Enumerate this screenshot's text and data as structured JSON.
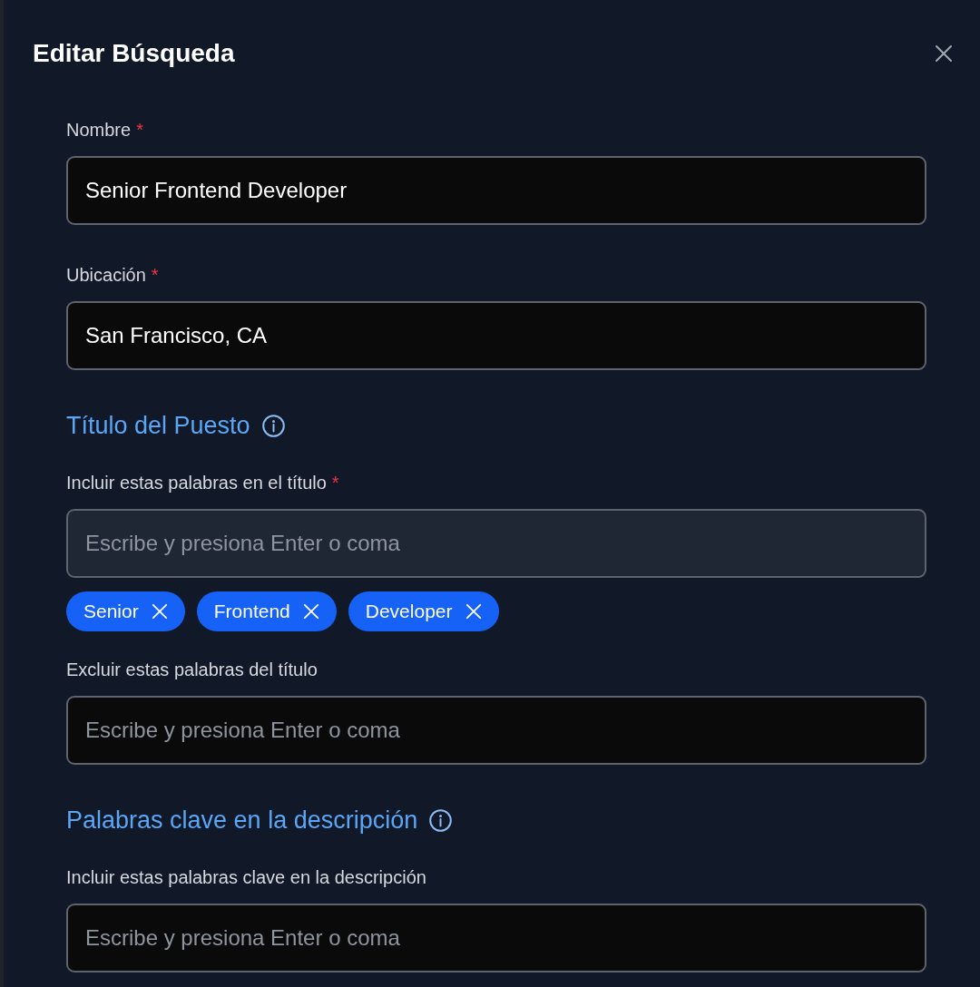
{
  "dialog": {
    "title": "Editar Búsqueda"
  },
  "sections": [
    {
      "fields": [
        {
          "label": "Nombre",
          "required_mark": "*",
          "value": "Senior Frontend Developer",
          "focused": false
        },
        {
          "label": "Ubicación",
          "required_mark": "*",
          "value": "San Francisco, CA",
          "focused": false
        }
      ]
    },
    {
      "heading": "Título del Puesto",
      "fields": [
        {
          "label": "Incluir estas palabras en el título",
          "required_mark": "*",
          "placeholder": "Escribe y presiona Enter o coma",
          "focused": true,
          "tags": [
            {
              "label": "Senior"
            },
            {
              "label": "Frontend"
            },
            {
              "label": "Developer"
            }
          ]
        },
        {
          "label": "Excluir estas palabras del título",
          "placeholder": "Escribe y presiona Enter o coma",
          "focused": false
        }
      ]
    },
    {
      "heading": "Palabras clave en la descripción",
      "fields": [
        {
          "label": "Incluir estas palabras clave en la descripción",
          "placeholder": "Escribe y presiona Enter o coma",
          "focused": false
        }
      ]
    }
  ]
}
